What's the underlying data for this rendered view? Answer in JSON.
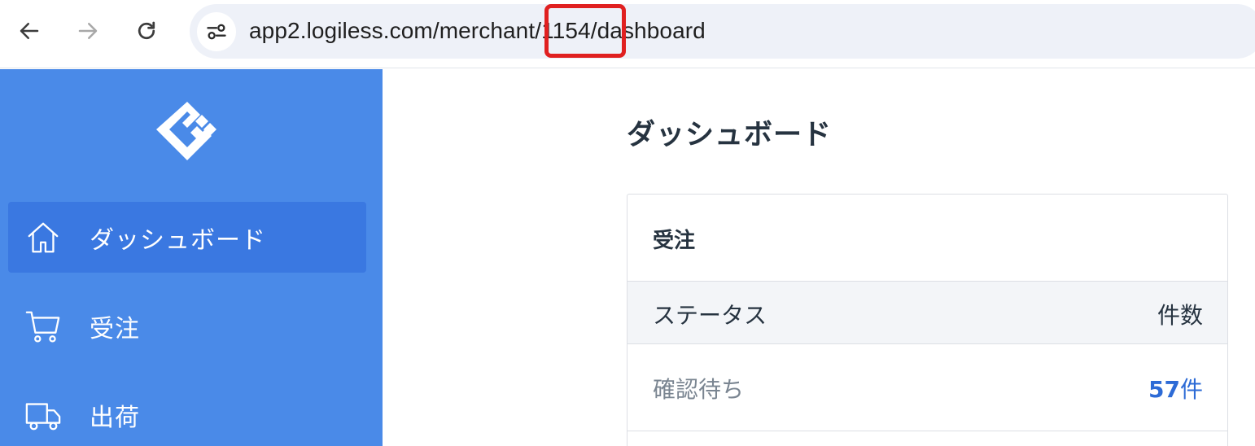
{
  "browser": {
    "url_prefix": "app2.logiless.com/merchant",
    "url_highlight": "/1154/",
    "url_suffix": "dashboard"
  },
  "sidebar": {
    "items": [
      {
        "label": "ダッシュボード",
        "icon": "home-icon",
        "active": true
      },
      {
        "label": "受注",
        "icon": "cart-icon",
        "active": false
      },
      {
        "label": "出荷",
        "icon": "truck-icon",
        "active": false
      }
    ]
  },
  "main": {
    "title": "ダッシュボード",
    "orders_card": {
      "title": "受注",
      "columns": [
        "ステータス",
        "件数"
      ],
      "rows": [
        {
          "status": "確認待ち",
          "count": "57",
          "unit": "件"
        }
      ]
    }
  },
  "colors": {
    "sidebar_bg": "#4a8ae8",
    "sidebar_active": "#3a78e1",
    "link": "#2d6bd6",
    "highlight": "#e02020"
  }
}
